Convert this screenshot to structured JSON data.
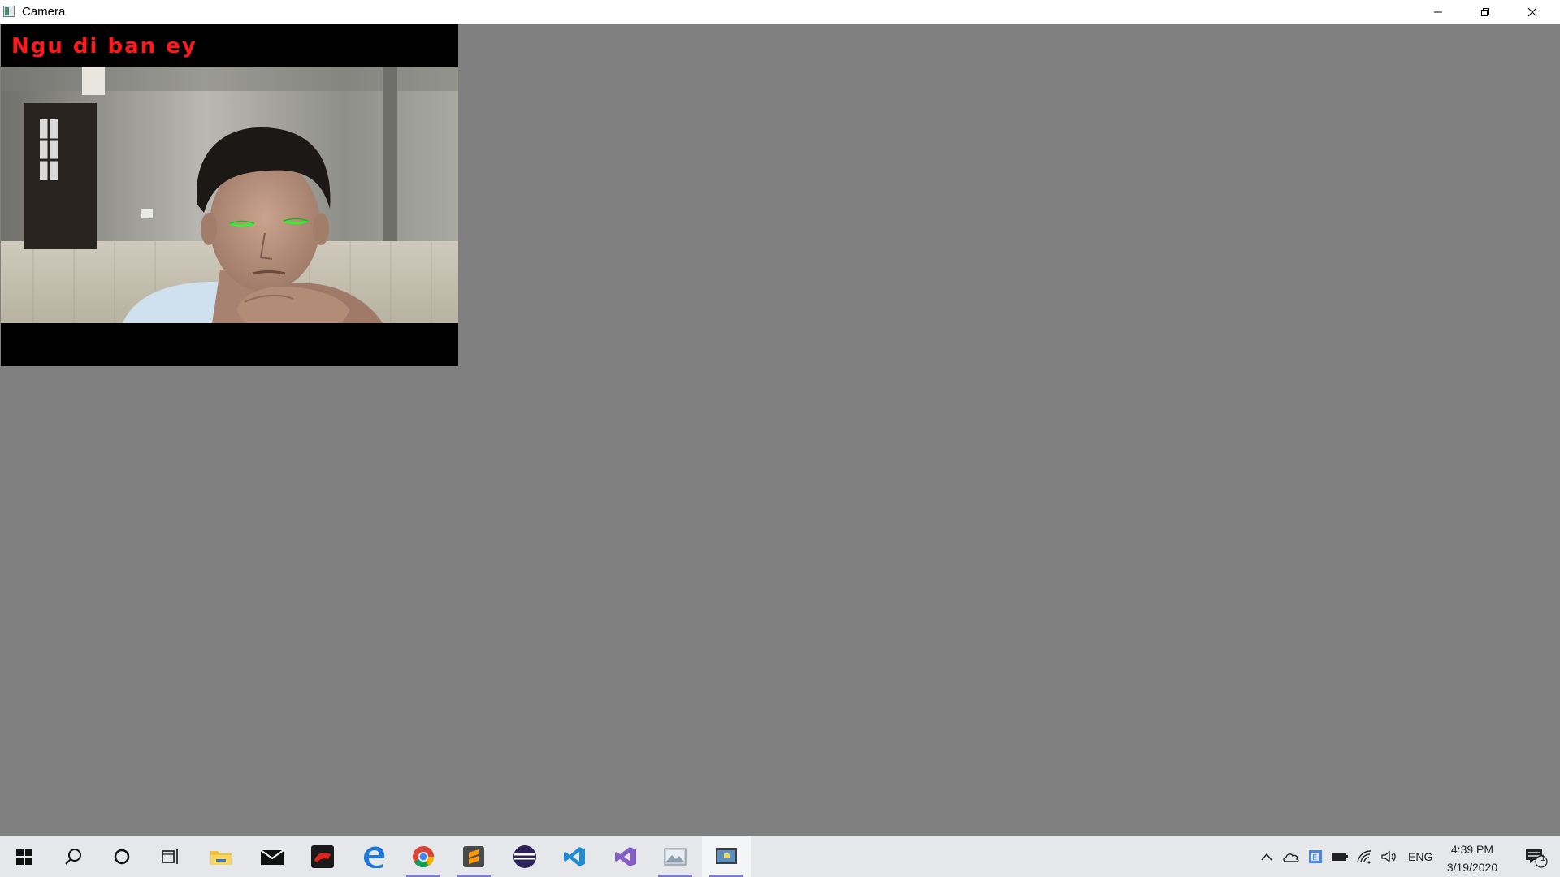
{
  "window": {
    "title": "Camera",
    "controls": {
      "minimize": "minimize",
      "restore": "restore",
      "close": "close"
    }
  },
  "camera": {
    "overlay_text": "Ngu di ban ey",
    "overlay_color": "#ff1a1a",
    "eye_marker_color": "#22ff22"
  },
  "taskbar": {
    "apps": [
      {
        "name": "start",
        "icon": "windows-logo-icon"
      },
      {
        "name": "search",
        "icon": "search-icon"
      },
      {
        "name": "cortana",
        "icon": "cortana-circle-icon"
      },
      {
        "name": "task-view",
        "icon": "task-view-icon"
      },
      {
        "name": "file-explorer",
        "icon": "folder-icon"
      },
      {
        "name": "mail",
        "icon": "mail-icon"
      },
      {
        "name": "game",
        "icon": "red-game-icon"
      },
      {
        "name": "edge",
        "icon": "edge-icon"
      },
      {
        "name": "chrome",
        "icon": "chrome-icon",
        "running": true
      },
      {
        "name": "sublime-text",
        "icon": "sublime-icon",
        "running": true
      },
      {
        "name": "eclipse",
        "icon": "eclipse-icon"
      },
      {
        "name": "vscode",
        "icon": "vscode-icon"
      },
      {
        "name": "visual-studio",
        "icon": "visual-studio-icon"
      },
      {
        "name": "photos",
        "icon": "image-viewer-icon",
        "running": true
      },
      {
        "name": "python",
        "icon": "python-window-icon",
        "running": true,
        "active": true
      }
    ],
    "tray": {
      "language": "ENG",
      "time": "4:39 PM",
      "date": "3/19/2020",
      "notification_count": "1"
    }
  }
}
